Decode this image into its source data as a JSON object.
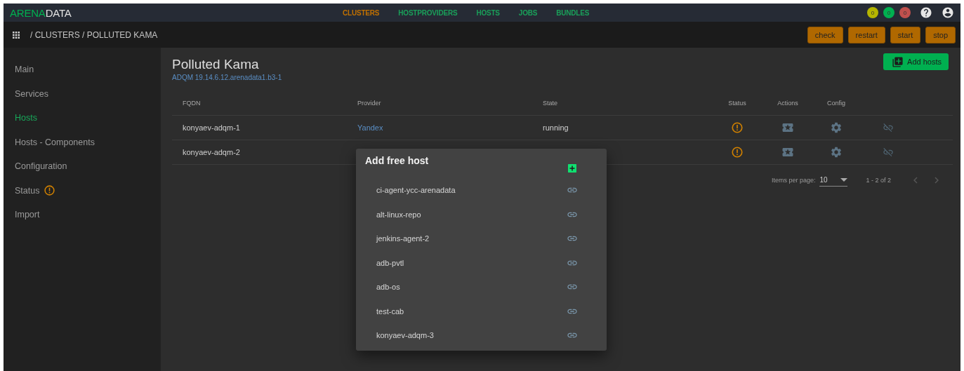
{
  "logo": {
    "accent": "ARENA",
    "rest": "DATA"
  },
  "nav": [
    {
      "label": "CLUSTERS",
      "selected": true
    },
    {
      "label": "HOSTPROVIDERS",
      "selected": false
    },
    {
      "label": "HOSTS",
      "selected": false
    },
    {
      "label": "JOBS",
      "selected": false
    },
    {
      "label": "BUNDLES",
      "selected": false
    }
  ],
  "badges": [
    {
      "count": "0",
      "color": "#b5b500"
    },
    {
      "count": "0",
      "color": "#00b050"
    },
    {
      "count": "0",
      "color": "#c0504d"
    }
  ],
  "breadcrumb": "/ CLUSTERS / POLLUTED KAMA",
  "actions": [
    "check",
    "restart",
    "start",
    "stop"
  ],
  "sidebar": [
    {
      "label": "Main",
      "kind": "link",
      "selected": false
    },
    {
      "label": "Services",
      "kind": "link",
      "selected": false
    },
    {
      "label": "Hosts",
      "kind": "link",
      "selected": true
    },
    {
      "label": "Hosts - Components",
      "kind": "link",
      "selected": false
    },
    {
      "label": "Configuration",
      "kind": "link",
      "selected": false
    },
    {
      "label": "Status",
      "kind": "status",
      "selected": false
    },
    {
      "label": "Import",
      "kind": "link",
      "selected": false
    }
  ],
  "page": {
    "title": "Polluted Kama",
    "subtitle": "ADQM 19.14.6.12.arenadata1.b3-1",
    "add_button": "Add hosts"
  },
  "table": {
    "columns": [
      "FQDN",
      "Provider",
      "State",
      "Status",
      "Actions",
      "Config"
    ],
    "rows": [
      {
        "fqdn": "konyaev-adqm-1",
        "provider": "Yandex",
        "state": "running"
      },
      {
        "fqdn": "konyaev-adqm-2"
      }
    ]
  },
  "paginator": {
    "label": "Items per page:",
    "page_size": "10",
    "range": "1 - 2 of 2"
  },
  "dialog": {
    "title": "Add free host",
    "hosts": [
      "ci-agent-ycc-arenadata",
      "alt-linux-repo",
      "jenkins-agent-2",
      "adb-pvtl",
      "adb-os",
      "test-cab",
      "konyaev-adqm-3"
    ]
  }
}
